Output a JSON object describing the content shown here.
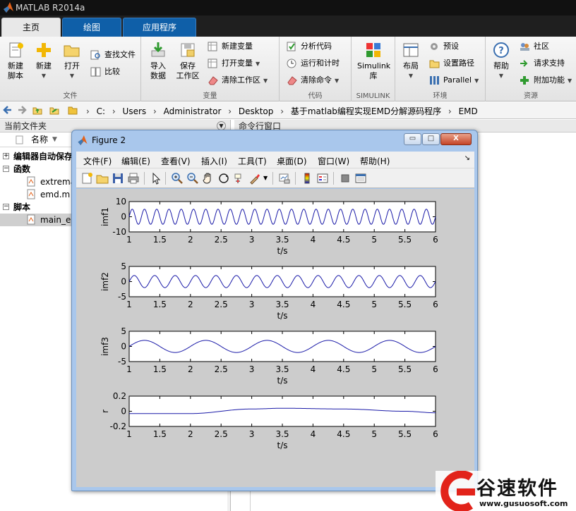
{
  "app": {
    "title": "MATLAB R2014a"
  },
  "tabs": [
    {
      "label": "主页",
      "active": true
    },
    {
      "label": "绘图",
      "active": false
    },
    {
      "label": "应用程序",
      "active": false
    }
  ],
  "ribbon": {
    "groups": {
      "file": "文件",
      "variable": "变量",
      "code": "代码",
      "simulink": "SIMULINK",
      "environment": "环境",
      "resources": "资源"
    },
    "new_script": [
      "新建",
      "脚本"
    ],
    "new": "新建",
    "open": "打开",
    "find_files": "查找文件",
    "compare": "比较",
    "import": [
      "导入",
      "数据"
    ],
    "save_ws": [
      "保存",
      "工作区"
    ],
    "new_var": "新建变量",
    "open_var": "打开变量",
    "clear_ws": "清除工作区",
    "analyze": "分析代码",
    "run_time": "运行和计时",
    "clear_cmd": "清除命令",
    "simulink": [
      "Simulink",
      "库"
    ],
    "layout": "布局",
    "prefs": "预设",
    "set_path": "设置路径",
    "parallel": "Parallel",
    "help": "帮助",
    "community": "社区",
    "support": "请求支持",
    "addons": "附加功能"
  },
  "address": {
    "crumbs": [
      "C:",
      "Users",
      "Administrator",
      "Desktop",
      "基于matlab编程实现EMD分解源码程序",
      "EMD"
    ]
  },
  "current_folder": {
    "title": "当前文件夹",
    "col_name": "名称",
    "rows": [
      {
        "label": "编辑器自动保存",
        "type": "group",
        "toggle": "+"
      },
      {
        "label": "函数",
        "type": "group",
        "toggle": "−"
      },
      {
        "label": "extrema",
        "type": "file"
      },
      {
        "label": "emd.m",
        "type": "file"
      },
      {
        "label": "脚本",
        "type": "group",
        "toggle": "−"
      },
      {
        "label": "main_er",
        "type": "file",
        "selected": true
      }
    ]
  },
  "command_window": {
    "title": "命令行窗口"
  },
  "figure": {
    "title": "Figure 2",
    "menu": [
      "文件(F)",
      "编辑(E)",
      "查看(V)",
      "插入(I)",
      "工具(T)",
      "桌面(D)",
      "窗口(W)",
      "帮助(H)"
    ],
    "window_buttons": {
      "minimize": "▭",
      "maximize": "□",
      "close": "X"
    }
  },
  "chart_data": [
    {
      "type": "line",
      "ylabel": "imf1",
      "xlabel": "t/s",
      "xlim": [
        1,
        6
      ],
      "ylim": [
        -10,
        10
      ],
      "yticks": [
        -10,
        0,
        10
      ],
      "xticks": [
        1,
        1.5,
        2,
        2.5,
        3,
        3.5,
        4,
        4.5,
        5,
        5.5,
        6
      ],
      "series": [
        {
          "x_range": [
            1,
            6
          ],
          "form": "sinusoid",
          "frequency_hz": 5,
          "amplitude": 5
        }
      ]
    },
    {
      "type": "line",
      "ylabel": "imf2",
      "xlabel": "t/s",
      "xlim": [
        1,
        6
      ],
      "ylim": [
        -5,
        5
      ],
      "yticks": [
        -5,
        0,
        5
      ],
      "xticks": [
        1,
        1.5,
        2,
        2.5,
        3,
        3.5,
        4,
        4.5,
        5,
        5.5,
        6
      ],
      "series": [
        {
          "x_range": [
            1,
            6
          ],
          "form": "sinusoid",
          "frequency_hz": 3,
          "amplitude": 2
        }
      ]
    },
    {
      "type": "line",
      "ylabel": "imf3",
      "xlabel": "t/s",
      "xlim": [
        1,
        6
      ],
      "ylim": [
        -5,
        5
      ],
      "yticks": [
        -5,
        0,
        5
      ],
      "xticks": [
        1,
        1.5,
        2,
        2.5,
        3,
        3.5,
        4,
        4.5,
        5,
        5.5,
        6
      ],
      "series": [
        {
          "x_range": [
            1,
            6
          ],
          "form": "sinusoid",
          "frequency_hz": 1,
          "amplitude": 2
        }
      ]
    },
    {
      "type": "line",
      "ylabel": "r",
      "xlabel": "t/s",
      "xlim": [
        1,
        6
      ],
      "ylim": [
        -0.2,
        0.2
      ],
      "yticks": [
        -0.2,
        0,
        0.2
      ],
      "xticks": [
        1,
        1.5,
        2,
        2.5,
        3,
        3.5,
        4,
        4.5,
        5,
        5.5,
        6
      ],
      "series": [
        {
          "x_range": [
            1,
            6
          ],
          "form": "slow-arc",
          "points": [
            [
              1,
              -0.03
            ],
            [
              2,
              -0.03
            ],
            [
              3,
              0.03
            ],
            [
              3.5,
              0.04
            ],
            [
              4.5,
              0.03
            ],
            [
              5.5,
              0.0
            ],
            [
              6,
              -0.02
            ]
          ]
        }
      ]
    }
  ],
  "colors": {
    "line": "#1a1aa8",
    "figure_bg": "#cccccc",
    "tab_blue": "#0f5fa8",
    "watermark_red": "#e2231a"
  },
  "watermark": {
    "name": "谷速软件",
    "url": "www.gusuosoft.com"
  }
}
